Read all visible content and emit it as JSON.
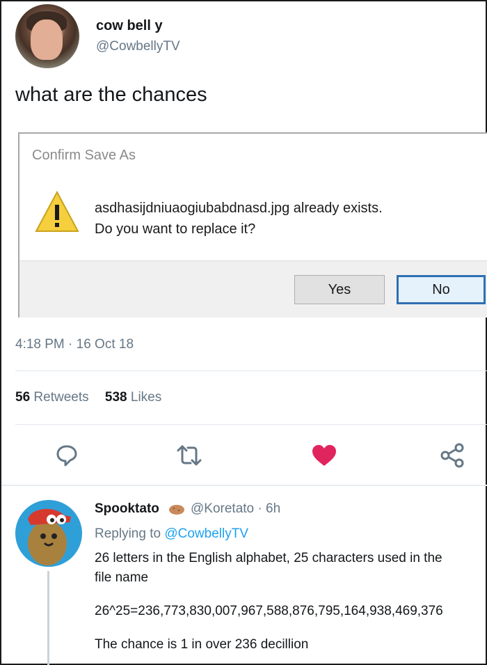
{
  "tweet": {
    "author_name": "cow bell y",
    "author_handle": "@CowbellyTV",
    "text": "what are the chances",
    "timestamp": "4:18 PM · 16 Oct 18",
    "retweets_count": "56",
    "retweets_label": "Retweets",
    "likes_count": "538",
    "likes_label": "Likes"
  },
  "dialog": {
    "title": "Confirm Save As",
    "message_line1": "asdhasijdniuaogiubabdnasd.jpg already exists.",
    "message_line2": "Do you want to replace it?",
    "yes_label": "Yes",
    "no_label": "No"
  },
  "actions": {
    "icons": [
      "reply-icon",
      "retweet-icon",
      "like-icon",
      "share-icon"
    ],
    "like_color": "#e0245e",
    "icon_color": "#657786"
  },
  "reply": {
    "author_name": "Spooktato",
    "author_handle": "@Koretato",
    "time": "· 6h",
    "replying_prefix": "Replying to",
    "replying_to": "@CowbellyTV",
    "line1": "26 letters in the English alphabet, 25 characters used in the",
    "line2": "file name",
    "line3": "26^25=236,773,830,007,967,588,876,795,164,938,469,376",
    "line4": "The chance is 1 in over 236 decillion"
  },
  "colors": {
    "link": "#1da1f2",
    "muted": "#657786",
    "dialog_focus": "#2f6fb2"
  }
}
